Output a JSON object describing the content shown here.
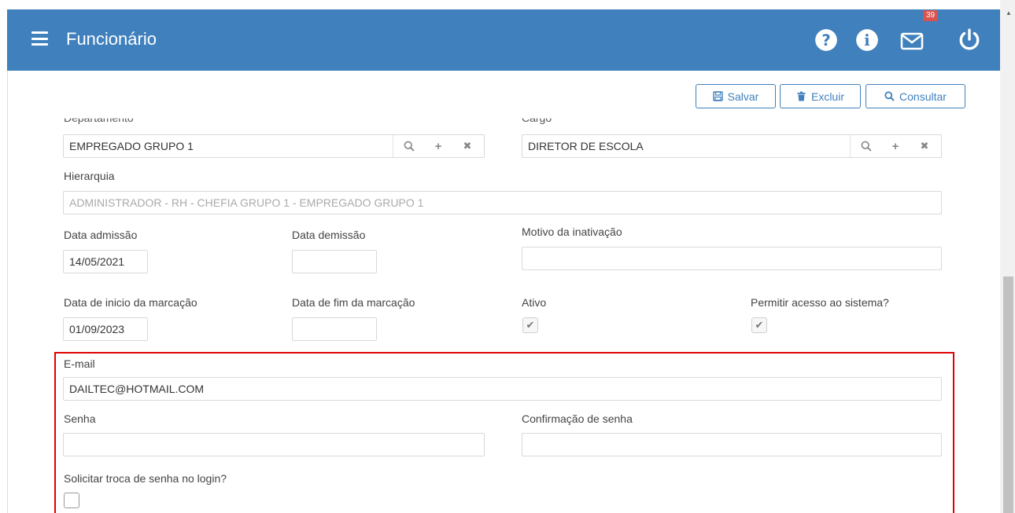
{
  "header": {
    "title": "Funcionário",
    "notification_count": "39",
    "icons": [
      "menu-icon",
      "help-icon",
      "info-icon",
      "mail-icon",
      "power-icon"
    ],
    "color": "#3f80bd"
  },
  "toolbar": {
    "save_label": "Salvar",
    "delete_label": "Excluir",
    "search_label": "Consultar"
  },
  "form": {
    "departamento": {
      "label": "Departamento",
      "value": "EMPREGADO GRUPO 1"
    },
    "cargo": {
      "label": "Cargo",
      "value": "DIRETOR DE ESCOLA"
    },
    "hierarquia": {
      "label": "Hierarquia",
      "value": "ADMINISTRADOR - RH - CHEFIA GRUPO 1 - EMPREGADO GRUPO 1"
    },
    "data_admissao": {
      "label": "Data admissão",
      "value": "14/05/2021"
    },
    "data_demissao": {
      "label": "Data demissão",
      "value": ""
    },
    "motivo_inativacao": {
      "label": "Motivo da inativação",
      "value": ""
    },
    "data_inicio_marcacao": {
      "label": "Data de inicio da marcação",
      "value": "01/09/2023"
    },
    "data_fim_marcacao": {
      "label": "Data de fim da marcação",
      "value": ""
    },
    "ativo": {
      "label": "Ativo",
      "checked": true
    },
    "permitir_acesso": {
      "label": "Permitir acesso ao sistema?",
      "checked": true
    },
    "email": {
      "label": "E-mail",
      "value": "DAILTEC@HOTMAIL.COM"
    },
    "senha": {
      "label": "Senha",
      "value": ""
    },
    "confirmacao_senha": {
      "label": "Confirmação de senha",
      "value": ""
    },
    "solicitar_troca": {
      "label": "Solicitar troca de senha no login?",
      "checked": false
    }
  },
  "highlight_color": "#e00000"
}
